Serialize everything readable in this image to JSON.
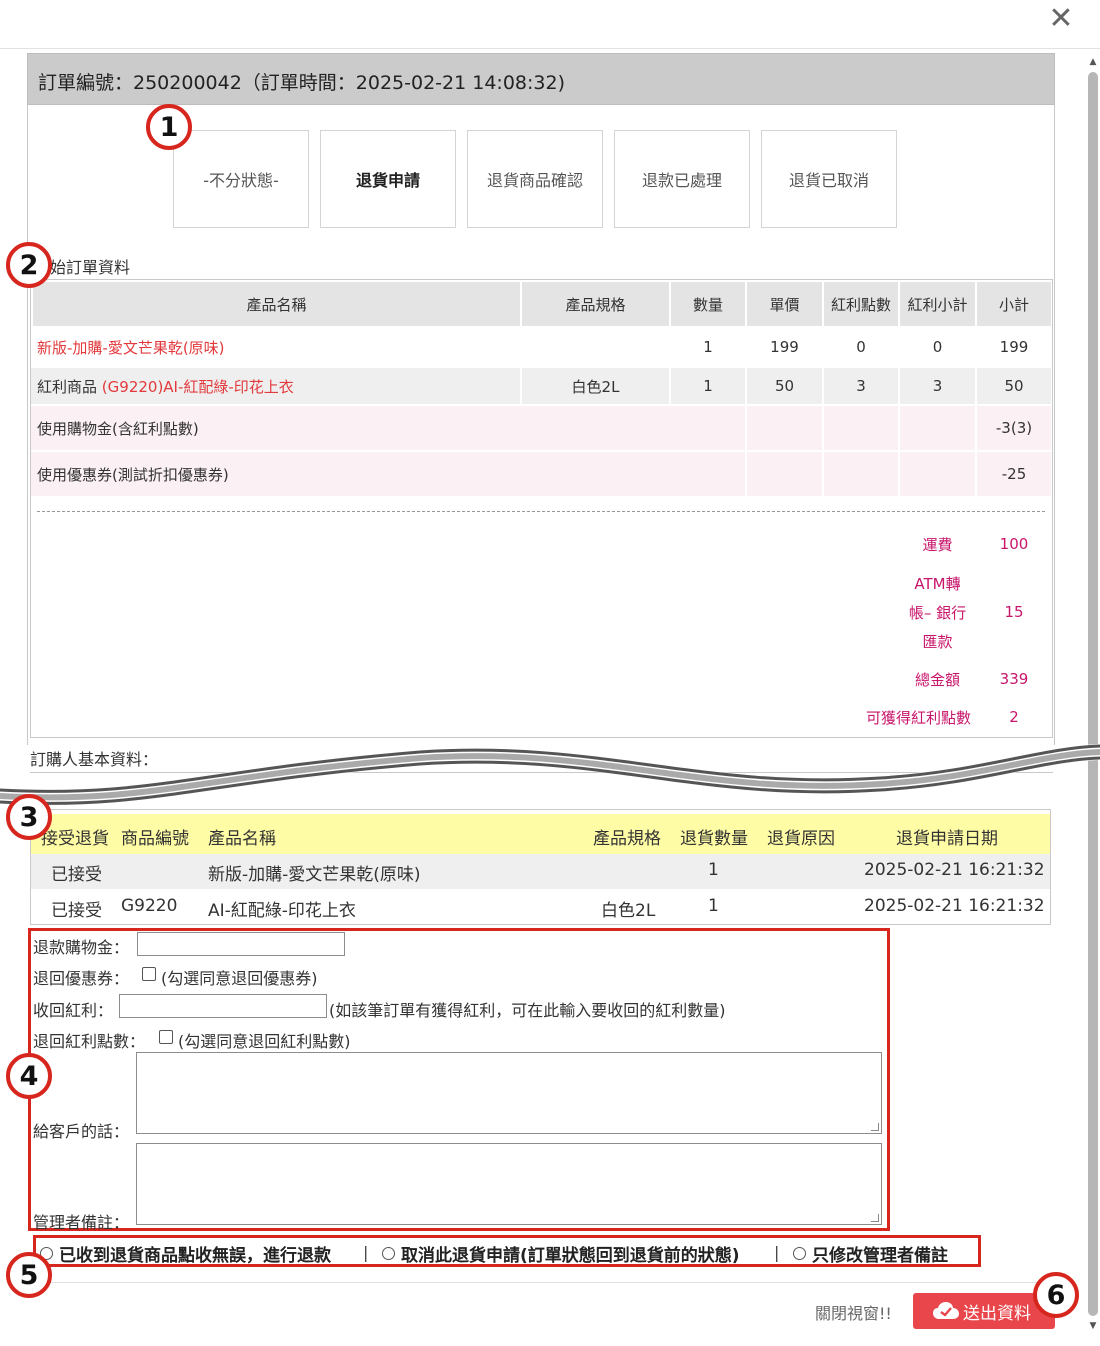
{
  "dialog": {
    "close_symbol": "✕"
  },
  "header": {
    "title": "訂單編號：250200042（訂單時間：2025-02-21 14:08:32)"
  },
  "status_tabs": [
    {
      "label": "-不分狀態-",
      "active": false
    },
    {
      "label": "退貨申請",
      "active": true
    },
    {
      "label": "退貨商品確認",
      "active": false
    },
    {
      "label": "退款已處理",
      "active": false
    },
    {
      "label": "退貨已取消",
      "active": false
    }
  ],
  "markers": [
    "1",
    "2",
    "3",
    "4",
    "5",
    "6"
  ],
  "order_section": {
    "label": "始訂單資料",
    "columns": [
      "產品名稱",
      "產品規格",
      "數量",
      "單價",
      "紅利點數",
      "紅利小計",
      "小計"
    ],
    "rows": [
      {
        "name_prefix": "",
        "name": "新版-加購-愛文芒果乾(原味)",
        "spec": "",
        "qty": "1",
        "price": "199",
        "bonus": "0",
        "bonus_subtotal": "0",
        "subtotal": "199"
      },
      {
        "name_prefix": "紅利商品 ",
        "name": "(G9220)AI-紅配綠-印花上衣",
        "spec": "白色2L",
        "qty": "1",
        "price": "50",
        "bonus": "3",
        "bonus_subtotal": "3",
        "subtotal": "50"
      }
    ],
    "adjustments": [
      {
        "label": "使用購物金(含紅利點數)",
        "value": "-3(3)"
      },
      {
        "label": "使用優惠券(測試折扣優惠券)",
        "value": "-25"
      }
    ],
    "summary": {
      "shipping_label": "運費",
      "shipping_value": "100",
      "payment_label_1": "ATM轉",
      "payment_label_2": "帳– 銀行",
      "payment_label_3": "匯款",
      "payment_value": "15",
      "total_label": "總金額",
      "total_value": "339",
      "bonus_label": "可獲得紅利點數",
      "bonus_value": "2"
    }
  },
  "buyer_section": {
    "label": "訂購人基本資料："
  },
  "return_table": {
    "columns": [
      "接受退貨",
      "商品編號",
      "產品名稱",
      "產品規格",
      "退貨數量",
      "退貨原因",
      "退貨申請日期"
    ],
    "rows": [
      {
        "accepted": "已接受",
        "code": "",
        "name": "新版-加購-愛文芒果乾(原味)",
        "spec": "",
        "qty": "1",
        "reason": "",
        "date": "2025-02-21 16:21:32"
      },
      {
        "accepted": "已接受",
        "code": "G9220",
        "name": "AI-紅配綠-印花上衣",
        "spec": "白色2L",
        "qty": "1",
        "reason": "",
        "date": "2025-02-21 16:21:32"
      }
    ]
  },
  "refund_form": {
    "refund_credit_label": "退款購物金：",
    "refund_credit_value": "",
    "return_coupon_label": "退回優惠券：",
    "return_coupon_hint": "(勾選同意退回優惠券)",
    "reclaim_bonus_label": "收回紅利：",
    "reclaim_bonus_value": "",
    "reclaim_bonus_hint": "(如該筆訂單有獲得紅利，可在此輸入要收回的紅利數量)",
    "return_bonus_label": "退回紅利點數：",
    "return_bonus_hint": "(勾選同意退回紅利點數)",
    "customer_message_label": "給客戶的話：",
    "admin_note_label": "管理者備註："
  },
  "actions": {
    "options": [
      "已收到退貨商品點收無誤，進行退款",
      "取消此退貨申請(訂單狀態回到退貨前的狀態)",
      "只修改管理者備註"
    ],
    "separator": "|",
    "close_label": "關閉視窗!!",
    "submit_label": "送出資料"
  },
  "colors": {
    "accent_red": "#d7261e",
    "link_red": "#e2393c",
    "summary_pink": "#c8166b",
    "submit_bg": "#e8464b",
    "return_header_bg": "#fffca6"
  }
}
